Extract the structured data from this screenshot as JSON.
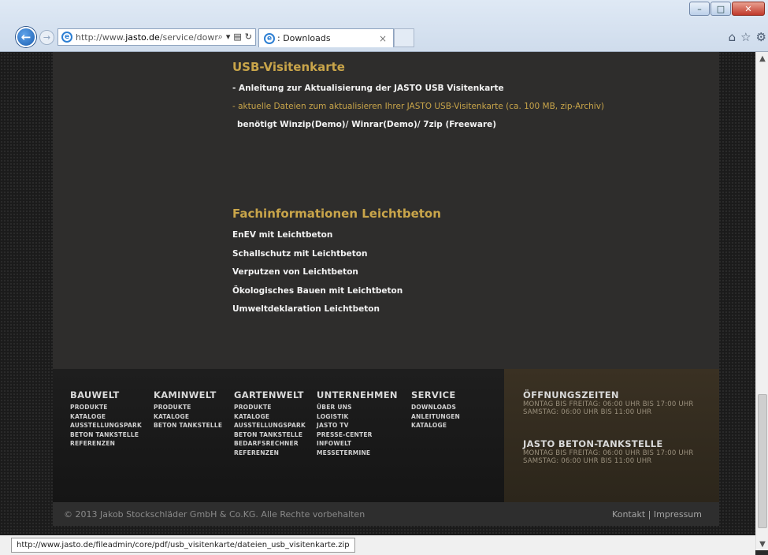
{
  "browser": {
    "address_prefix": "http://www.",
    "address_domain": "jasto.de",
    "address_path": "/service/down",
    "tab_title": ": Downloads",
    "status_url": "http://www.jasto.de/fileadmin/core/pdf/usb_visitenkarte/dateien_usb_visitenkarte.zip"
  },
  "usb": {
    "heading": "USB-Visitenkarte",
    "line1": "- Anleitung zur Aktualisierung der JASTO USB Visitenkarte",
    "line2": "- aktuelle Dateien zum aktualisieren Ihrer JASTO USB-Visitenkarte (ca. 100 MB, zip-Archiv)",
    "line3": "benötigt Winzip(Demo)/ Winrar(Demo)/ 7zip (Freeware)"
  },
  "fach": {
    "heading": "Fachinformationen Leichtbeton",
    "links": [
      "EnEV mit Leichtbeton",
      "Schallschutz mit Leichtbeton",
      "Verputzen von Leichtbeton",
      "Ökologisches Bauen mit Leichtbeton",
      "Umweltdeklaration Leichtbeton"
    ]
  },
  "footer": {
    "columns": [
      {
        "title": "BAUWELT",
        "items": [
          "PRODUKTE",
          "KATALOGE",
          "AUSSTELLUNGSPARK",
          "BETON TANKSTELLE",
          "REFERENZEN"
        ]
      },
      {
        "title": "KAMINWELT",
        "items": [
          "PRODUKTE",
          "KATALOGE",
          "BETON TANKSTELLE"
        ]
      },
      {
        "title": "GARTENWELT",
        "items": [
          "PRODUKTE",
          "KATALOGE",
          "AUSSTELLUNGSPARK",
          "BETON TANKSTELLE",
          "BEDARFSRECHNER",
          "REFERENZEN"
        ]
      },
      {
        "title": "UNTERNEHMEN",
        "items": [
          "ÜBER UNS",
          "LOGISTIK",
          "JASTO TV",
          "PRESSE-CENTER",
          "INFOWELT",
          "MESSETERMINE"
        ]
      },
      {
        "title": "SERVICE",
        "items": [
          "DOWNLOADS",
          "ANLEITUNGEN",
          "KATALOGE"
        ]
      }
    ],
    "hours": [
      {
        "title": "ÖFFNUNGSZEITEN",
        "lines": [
          "MONTAG BIS FREITAG: 06:00 UHR BIS 17:00 UHR",
          "SAMSTAG: 06:00 UHR BIS 11:00 UHR"
        ]
      },
      {
        "title": "JASTO BETON-TANKSTELLE",
        "lines": [
          "MONTAG BIS FREITAG: 06:00 UHR BIS 17:00 UHR",
          "SAMSTAG: 06:00 UHR BIS 11:00 UHR"
        ]
      }
    ],
    "copyright": "© 2013 Jakob Stockschläder GmbH & Co.KG. Alle Rechte vorbehalten",
    "kontakt": "Kontakt",
    "separator": " | ",
    "impressum": "Impressum"
  }
}
